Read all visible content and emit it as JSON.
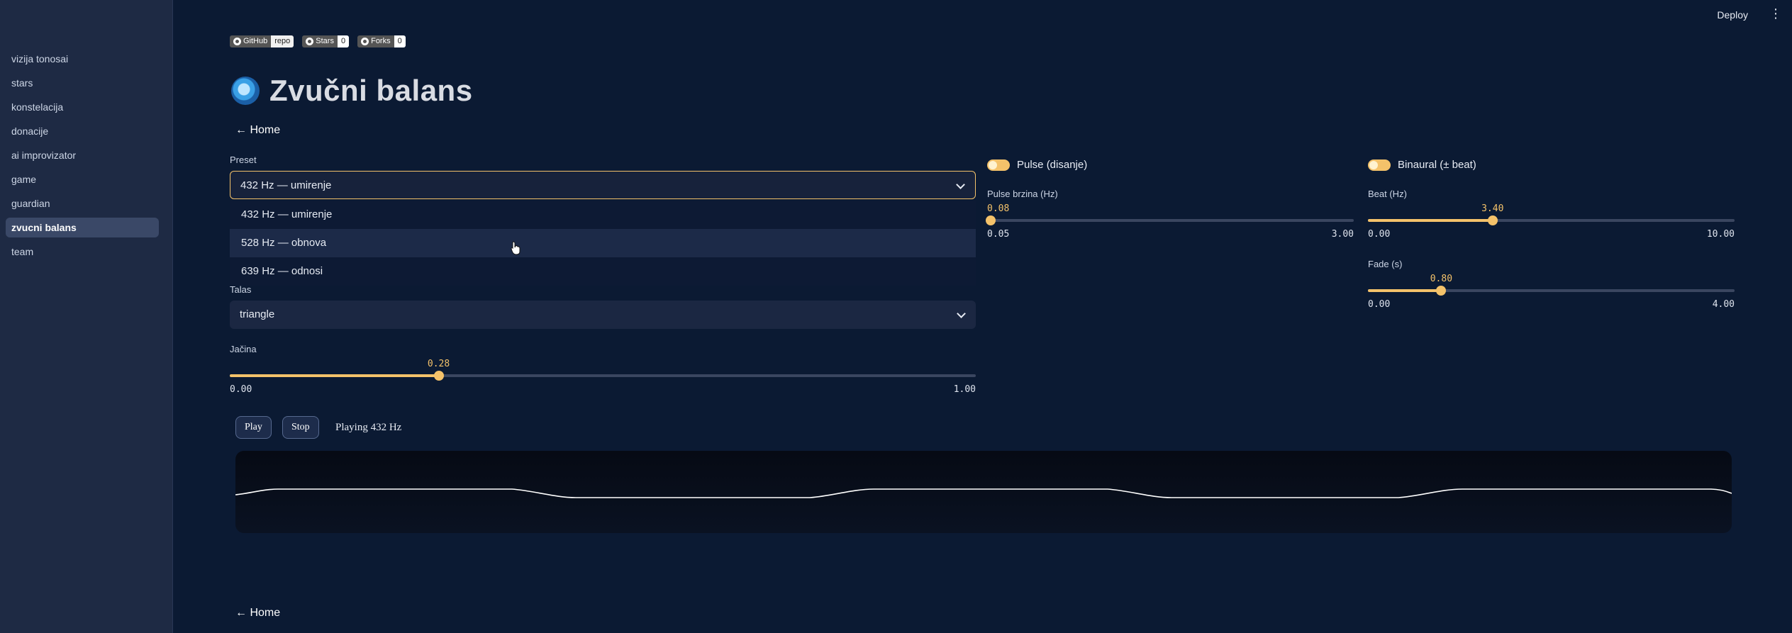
{
  "app": {
    "deploy_label": "Deploy",
    "menu_icon": "kebab-menu-icon"
  },
  "sidebar": {
    "items": [
      {
        "label": "vizija tonosai"
      },
      {
        "label": "stars"
      },
      {
        "label": "konstelacija"
      },
      {
        "label": "donacije"
      },
      {
        "label": "ai improvizator"
      },
      {
        "label": "game"
      },
      {
        "label": "guardian"
      },
      {
        "label": "zvucni balans",
        "active": true
      },
      {
        "label": "team"
      }
    ]
  },
  "badges": {
    "github": {
      "left": "GitHub",
      "right": "repo"
    },
    "stars": {
      "left": "Stars",
      "right": "0"
    },
    "forks": {
      "left": "Forks",
      "right": "0"
    }
  },
  "page": {
    "title": "Zvučni balans",
    "home_top": "← Home",
    "home_bottom": "← Home"
  },
  "preset": {
    "label": "Preset",
    "value": "432 Hz — umirenje",
    "options": [
      "432 Hz — umirenje",
      "528 Hz — obnova",
      "639 Hz — odnosi"
    ],
    "hovered_index": 1
  },
  "talas": {
    "label": "Talas",
    "value": "triangle"
  },
  "jacina": {
    "label": "Jačina",
    "value": "0.28",
    "min": "0.00",
    "max": "1.00",
    "fraction": 0.28
  },
  "pulse": {
    "toggle_label": "Pulse (disanje)",
    "speed": {
      "label": "Pulse brzina (Hz)",
      "value": "0.08",
      "min": "0.05",
      "max": "3.00",
      "fraction": 0.0102
    }
  },
  "binaural": {
    "toggle_label": "Binaural (± beat)",
    "beat": {
      "label": "Beat (Hz)",
      "value": "3.40",
      "min": "0.00",
      "max": "10.00",
      "fraction": 0.34
    },
    "fade": {
      "label": "Fade (s)",
      "value": "0.80",
      "min": "0.00",
      "max": "4.00",
      "fraction": 0.2
    }
  },
  "controls": {
    "play_label": "Play",
    "stop_label": "Stop",
    "status": "Playing 432 Hz"
  },
  "colors": {
    "accent": "#f4c26a",
    "background": "#0b1a33",
    "sidebar": "#1e2a44"
  }
}
